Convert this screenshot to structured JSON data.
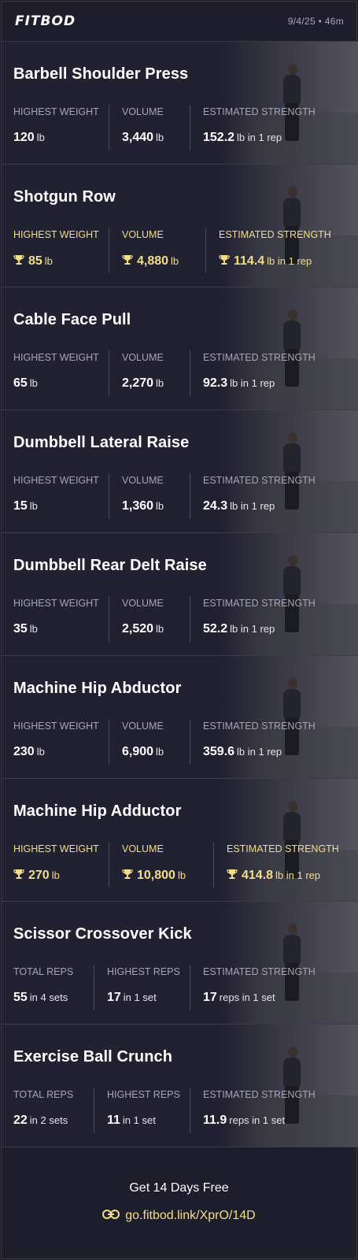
{
  "header": {
    "logo": "FITBOD",
    "meta": "9/4/25 • 46m"
  },
  "exercises": [
    {
      "name": "Barbell Shoulder Press",
      "stats": [
        {
          "label": "HIGHEST WEIGHT",
          "value": "120",
          "unit": "lb",
          "pr": false
        },
        {
          "label": "VOLUME",
          "value": "3,440",
          "unit": "lb",
          "pr": false
        },
        {
          "label": "ESTIMATED STRENGTH",
          "value": "152.2",
          "unit": "lb in 1 rep",
          "pr": false
        }
      ]
    },
    {
      "name": "Shotgun Row",
      "stats": [
        {
          "label": "HIGHEST WEIGHT",
          "value": "85",
          "unit": "lb",
          "pr": true
        },
        {
          "label": "VOLUME",
          "value": "4,880",
          "unit": "lb",
          "pr": true
        },
        {
          "label": "ESTIMATED STRENGTH",
          "value": "114.4",
          "unit": "lb in 1 rep",
          "pr": true
        }
      ]
    },
    {
      "name": "Cable Face Pull",
      "stats": [
        {
          "label": "HIGHEST WEIGHT",
          "value": "65",
          "unit": "lb",
          "pr": false
        },
        {
          "label": "VOLUME",
          "value": "2,270",
          "unit": "lb",
          "pr": false
        },
        {
          "label": "ESTIMATED STRENGTH",
          "value": "92.3",
          "unit": "lb in 1 rep",
          "pr": false
        }
      ]
    },
    {
      "name": "Dumbbell Lateral Raise",
      "stats": [
        {
          "label": "HIGHEST WEIGHT",
          "value": "15",
          "unit": "lb",
          "pr": false
        },
        {
          "label": "VOLUME",
          "value": "1,360",
          "unit": "lb",
          "pr": false
        },
        {
          "label": "ESTIMATED STRENGTH",
          "value": "24.3",
          "unit": "lb in 1 rep",
          "pr": false
        }
      ]
    },
    {
      "name": "Dumbbell Rear Delt Raise",
      "stats": [
        {
          "label": "HIGHEST WEIGHT",
          "value": "35",
          "unit": "lb",
          "pr": false
        },
        {
          "label": "VOLUME",
          "value": "2,520",
          "unit": "lb",
          "pr": false
        },
        {
          "label": "ESTIMATED STRENGTH",
          "value": "52.2",
          "unit": "lb in 1 rep",
          "pr": false
        }
      ]
    },
    {
      "name": "Machine Hip Abductor",
      "stats": [
        {
          "label": "HIGHEST WEIGHT",
          "value": "230",
          "unit": "lb",
          "pr": false
        },
        {
          "label": "VOLUME",
          "value": "6,900",
          "unit": "lb",
          "pr": false
        },
        {
          "label": "ESTIMATED STRENGTH",
          "value": "359.6",
          "unit": "lb in 1 rep",
          "pr": false
        }
      ]
    },
    {
      "name": "Machine Hip Adductor",
      "stats": [
        {
          "label": "HIGHEST WEIGHT",
          "value": "270",
          "unit": "lb",
          "pr": true
        },
        {
          "label": "VOLUME",
          "value": "10,800",
          "unit": "lb",
          "pr": true
        },
        {
          "label": "ESTIMATED STRENGTH",
          "value": "414.8",
          "unit": "lb in 1 rep",
          "pr": true
        }
      ]
    },
    {
      "name": "Scissor Crossover Kick",
      "stats": [
        {
          "label": "TOTAL REPS",
          "value": "55",
          "unit": "in 4 sets",
          "pr": false
        },
        {
          "label": "HIGHEST REPS",
          "value": "17",
          "unit": "in 1 set",
          "pr": false
        },
        {
          "label": "ESTIMATED STRENGTH",
          "value": "17",
          "unit": "reps in 1 set",
          "pr": false
        }
      ]
    },
    {
      "name": "Exercise Ball Crunch",
      "stats": [
        {
          "label": "TOTAL REPS",
          "value": "22",
          "unit": "in 2 sets",
          "pr": false
        },
        {
          "label": "HIGHEST REPS",
          "value": "11",
          "unit": "in 1 set",
          "pr": false
        },
        {
          "label": "ESTIMATED STRENGTH",
          "value": "11.9",
          "unit": "reps in 1 set",
          "pr": false
        }
      ]
    }
  ],
  "footer": {
    "cta": "Get 14 Days Free",
    "link": "go.fitbod.link/XprO/14D",
    "link_icon": "link-icon"
  },
  "colors": {
    "background": "#1e1d2b",
    "pr_gold": "#f3df8a",
    "label_gray": "#a6a5b6"
  }
}
